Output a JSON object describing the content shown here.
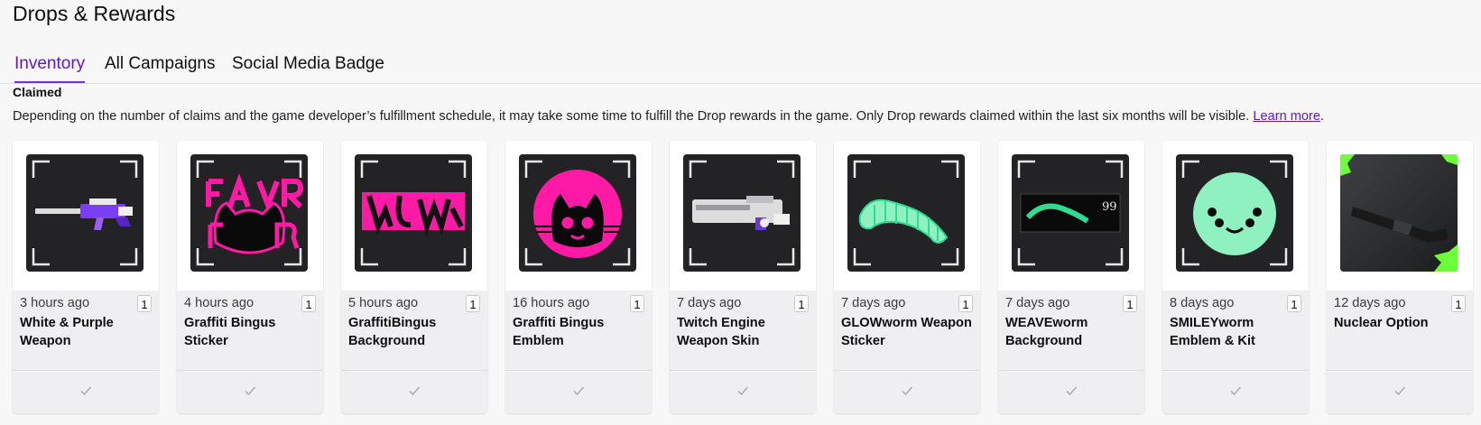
{
  "page": {
    "title": "Drops & Rewards"
  },
  "tabs": [
    {
      "label": "Inventory",
      "active": true
    },
    {
      "label": "All Campaigns",
      "active": false
    },
    {
      "label": "Social Media Badge",
      "active": false
    }
  ],
  "claimed": {
    "heading": "Claimed",
    "info": "Depending on the number of claims and the game developer’s fulfillment schedule, it may take some time to fulfill the Drop rewards in the game. Only Drop rewards claimed within the last six months will be visible.",
    "link_label": "Learn more",
    "link_suffix": "."
  },
  "colors": {
    "accent": "#772ce8",
    "tab_active_text": "#5c16c5",
    "card_bg": "#efeff1",
    "thumb_bg": "#232325"
  },
  "items": [
    {
      "time": "3 hours ago",
      "qty": "1",
      "name": "White & Purple Weapon",
      "image": "white-purple-rifle"
    },
    {
      "time": "4 hours ago",
      "qty": "1",
      "name": "Graffiti Bingus Sticker",
      "image": "bingus-sticker"
    },
    {
      "time": "5 hours ago",
      "qty": "1",
      "name": "GraffitiBingus Background",
      "image": "bingus-background"
    },
    {
      "time": "16 hours ago",
      "qty": "1",
      "name": "Graffiti Bingus Emblem",
      "image": "bingus-emblem"
    },
    {
      "time": "7 days ago",
      "qty": "1",
      "name": "Twitch Engine Weapon Skin",
      "image": "engine-weapon"
    },
    {
      "time": "7 days ago",
      "qty": "1",
      "name": "GLOWworm Weapon Sticker",
      "image": "glowworm"
    },
    {
      "time": "7 days ago",
      "qty": "1",
      "name": "WEAVEworm Background",
      "image": "weaveworm"
    },
    {
      "time": "8 days ago",
      "qty": "1",
      "name": "SMILEYworm Emblem & Kit",
      "image": "smiley"
    },
    {
      "time": "12 days ago",
      "qty": "1",
      "name": "Nuclear Option",
      "image": "nuclear-option"
    }
  ],
  "weaveworm_number": "99",
  "footer_icon": "checkmark-icon"
}
